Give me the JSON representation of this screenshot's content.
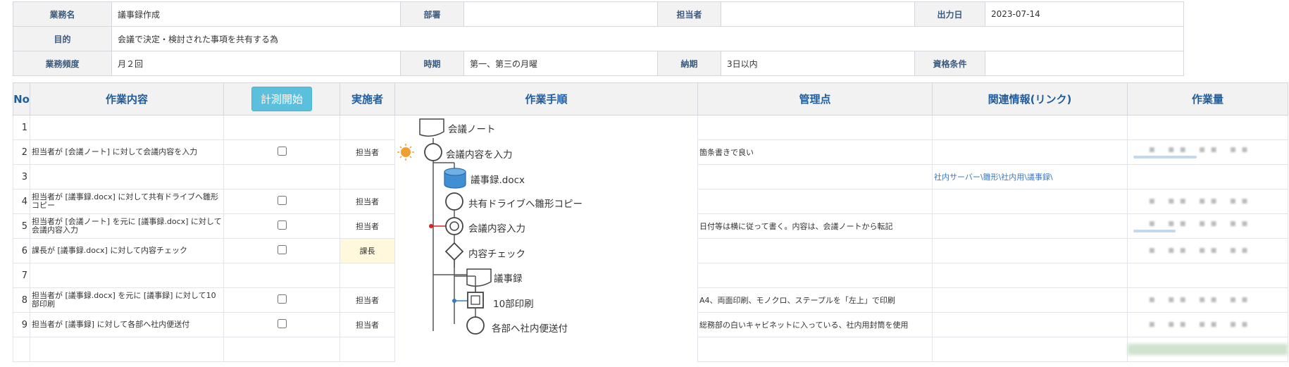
{
  "header": {
    "business_name_label": "業務名",
    "business_name_value": "議事録作成",
    "department_label": "部署",
    "department_value": "",
    "person_label": "担当者",
    "person_value": "",
    "output_date_label": "出力日",
    "output_date_value": "2023-07-14",
    "purpose_label": "目的",
    "purpose_value": "会議で決定・検討された事項を共有する為",
    "frequency_label": "業務頻度",
    "frequency_value": "月２回",
    "timing_label": "時期",
    "timing_value": "第一、第三の月曜",
    "deadline_label": "納期",
    "deadline_value": "3日以内",
    "qualification_label": "資格条件",
    "qualification_value": ""
  },
  "columns": {
    "no": "No",
    "content": "作業内容",
    "measure_button": "計測開始",
    "worker": "実施者",
    "procedure": "作業手順",
    "control_point": "管理点",
    "related_info": "関連情報(リンク)",
    "workload": "作業量"
  },
  "rows": [
    {
      "no": "1",
      "content": "",
      "worker": "",
      "control": "",
      "link": ""
    },
    {
      "no": "2",
      "content": "担当者が [会議ノート] に対して会議内容を入力",
      "worker": "担当者",
      "control": "箇条書きで良い",
      "link": ""
    },
    {
      "no": "3",
      "content": "",
      "worker": "",
      "control": "",
      "link": "社内サーバー\\雛形\\社内用\\議事録\\"
    },
    {
      "no": "4",
      "content": "担当者が [議事録.docx] に対して共有ドライブへ雛形コピー",
      "worker": "担当者",
      "control": "",
      "link": ""
    },
    {
      "no": "5",
      "content": "担当者が [会議ノート] を元に [議事録.docx] に対して会議内容入力",
      "worker": "担当者",
      "control": "日付等は横に従って書く。内容は、会議ノートから転記",
      "link": ""
    },
    {
      "no": "6",
      "content": "課長が [議事録.docx] に対して内容チェック",
      "worker": "課長",
      "control": "",
      "link": ""
    },
    {
      "no": "7",
      "content": "",
      "worker": "",
      "control": "",
      "link": ""
    },
    {
      "no": "8",
      "content": "担当者が [議事録.docx] を元に [議事録] に対して10部印刷",
      "worker": "担当者",
      "control": "A4、両面印刷、モノクロ、ステープルを「左上」で印刷",
      "link": ""
    },
    {
      "no": "9",
      "content": "担当者が [議事録] に対して各部へ社内便送付",
      "worker": "担当者",
      "control": "総務部の白いキャビネットに入っている、社内用封筒を使用",
      "link": ""
    },
    {
      "no": "",
      "content": "",
      "worker": "",
      "control": "",
      "link": ""
    }
  ],
  "flow_steps": [
    {
      "label": "会議ノート",
      "shape": "document"
    },
    {
      "label": "会議内容を入力",
      "shape": "circle"
    },
    {
      "label": "議事録.docx",
      "shape": "database"
    },
    {
      "label": "共有ドライブへ雛形コピー",
      "shape": "circle"
    },
    {
      "label": "会議内容入力",
      "shape": "double-circle"
    },
    {
      "label": "内容チェック",
      "shape": "diamond"
    },
    {
      "label": "議事録",
      "shape": "document"
    },
    {
      "label": "10部印刷",
      "shape": "square"
    },
    {
      "label": "各部へ社内便送付",
      "shape": "circle"
    }
  ],
  "colors": {
    "header_label": "#3a5a80",
    "column_header": "#1f5d9e",
    "button": "#5bc0de",
    "link": "#3b78c2",
    "highlight_worker": "#fff8dc",
    "db_icon": "#3f8fd2",
    "sun_icon": "#f0a030",
    "red_connector": "#e02020",
    "blue_connector": "#3b78c2"
  }
}
